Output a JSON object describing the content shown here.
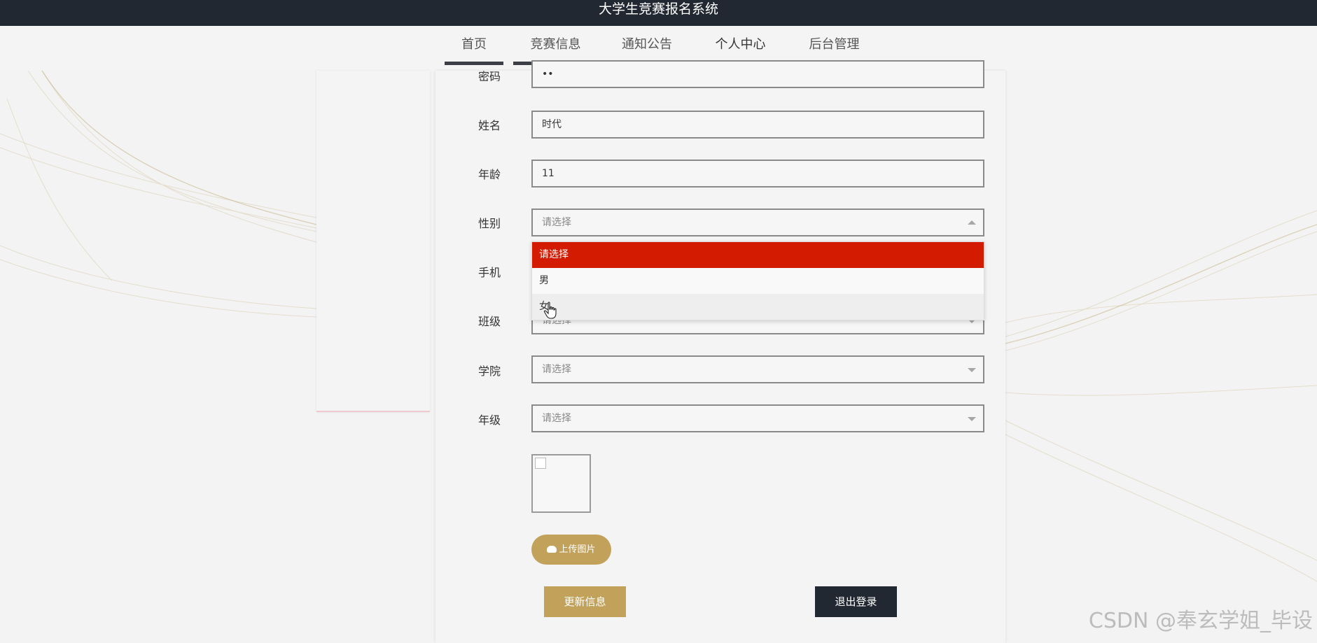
{
  "app": {
    "title": "大学生竞赛报名系统"
  },
  "nav": {
    "items": [
      {
        "label": "首页",
        "active": false
      },
      {
        "label": "竞赛信息",
        "active": false
      },
      {
        "label": "通知公告",
        "active": false
      },
      {
        "label": "个人中心",
        "active": true
      },
      {
        "label": "后台管理",
        "active": false
      }
    ]
  },
  "form": {
    "password": {
      "label": "密码",
      "value": "••"
    },
    "name": {
      "label": "姓名",
      "value": "时代"
    },
    "age": {
      "label": "年龄",
      "value": "11"
    },
    "gender": {
      "label": "性别",
      "value": "请选择"
    },
    "phone": {
      "label": "手机"
    },
    "class": {
      "label": "班级",
      "value": "请选择"
    },
    "college": {
      "label": "学院",
      "value": "请选择"
    },
    "grade": {
      "label": "年级",
      "value": "请选择"
    }
  },
  "gender_dropdown": {
    "options": [
      "请选择",
      "男",
      "女"
    ],
    "selected": "请选择",
    "hovered": "女"
  },
  "upload": {
    "label": "上传图片",
    "icon": "cloud-upload-icon"
  },
  "actions": {
    "update_label": "更新信息",
    "logout_label": "退出登录"
  },
  "watermark": "CSDN @奉玄学姐_毕设",
  "colors": {
    "topbar": "#222832",
    "accent": "#c2a25a",
    "selected_option": "#d21b00",
    "nav_bar": "#3c3f45"
  }
}
